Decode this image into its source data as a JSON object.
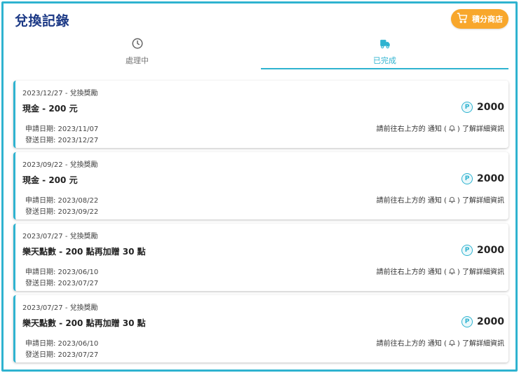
{
  "header": {
    "title": "兌換記錄",
    "shop_label": "積分商店"
  },
  "tabs": [
    {
      "label": "處理中",
      "icon": "clock-icon",
      "active": false
    },
    {
      "label": "已完成",
      "icon": "truck-icon",
      "active": true
    }
  ],
  "colors": {
    "accent": "#2fb3d0",
    "title": "#1d3a86",
    "shop": "#f8a72c"
  },
  "records": [
    {
      "date_line": "2023/12/27 - 兌換獎勵",
      "item": "現金 - 200 元",
      "apply": "申請日期: 2023/11/07",
      "send": "發送日期: 2023/12/27",
      "points": "2000",
      "note_prefix": "請前往右上方的 通知 (",
      "note_suffix": ") 了解詳細資訊"
    },
    {
      "date_line": "2023/09/22 - 兌換獎勵",
      "item": "現金 - 200 元",
      "apply": "申請日期: 2023/08/22",
      "send": "發送日期: 2023/09/22",
      "points": "2000",
      "note_prefix": "請前往右上方的 通知 (",
      "note_suffix": ") 了解詳細資訊"
    },
    {
      "date_line": "2023/07/27 - 兌換獎勵",
      "item": "樂天點數 - 200 點再加贈 30 點",
      "apply": "申請日期: 2023/06/10",
      "send": "發送日期: 2023/07/27",
      "points": "2000",
      "note_prefix": "請前往右上方的 通知 (",
      "note_suffix": ") 了解詳細資訊"
    },
    {
      "date_line": "2023/07/27 - 兌換獎勵",
      "item": "樂天點數 - 200 點再加贈 30 點",
      "apply": "申請日期: 2023/06/10",
      "send": "發送日期: 2023/07/27",
      "points": "2000",
      "note_prefix": "請前往右上方的 通知 (",
      "note_suffix": ") 了解詳細資訊"
    }
  ],
  "point_symbol": "P"
}
